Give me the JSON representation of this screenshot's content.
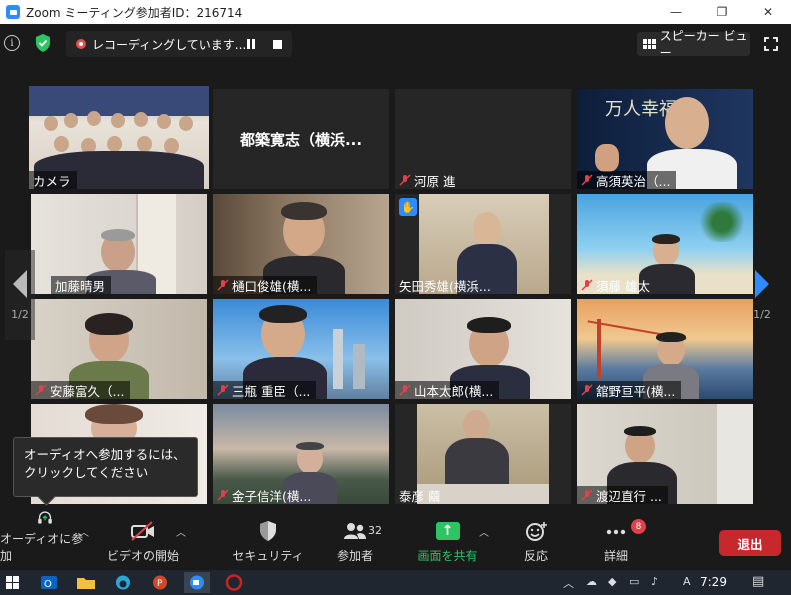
{
  "window": {
    "title": "Zoom ミーティング参加者ID：216714",
    "controls": [
      "—",
      "❐",
      "✕"
    ]
  },
  "topbar": {
    "recording_text": "レコーディングしています...",
    "speaker_view_label": "スピーカー ビュー"
  },
  "participants": [
    {
      "name": "カメラ",
      "muted": false,
      "active": true
    },
    {
      "name": "都築寛志（横浜...",
      "muted": false,
      "video_off": true
    },
    {
      "name": "河原 進",
      "muted": true
    },
    {
      "name": "高須英治（...",
      "muted": true,
      "background_text": "万人幸福栞"
    },
    {
      "name": "加藤晴男",
      "muted": false
    },
    {
      "name": "樋口俊雄(横...",
      "muted": true
    },
    {
      "name": "矢田秀雄(横浜...",
      "muted": false,
      "hand_raised": true
    },
    {
      "name": "須藤 雄太",
      "muted": true
    },
    {
      "name": "安藤富久（...",
      "muted": true
    },
    {
      "name": "三瓶 重臣（...",
      "muted": true
    },
    {
      "name": "山本太郎(横...",
      "muted": true
    },
    {
      "name": "舘野亘平(横...",
      "muted": true
    },
    {
      "name": "",
      "muted": false
    },
    {
      "name": "金子信洋(横...",
      "muted": true
    },
    {
      "name": "泰彦 繭",
      "muted": false
    },
    {
      "name": "渡辺直行 ...",
      "muted": true
    }
  ],
  "pagination": {
    "left": "1/2",
    "right": "1/2"
  },
  "tooltip": {
    "text": "オーディオへ参加するには、クリックしてください"
  },
  "toolbar": {
    "audio_label": "オーディオに参加",
    "video_label": "ビデオの開始",
    "security_label": "セキュリティ",
    "participants_label": "参加者",
    "participants_count": "32",
    "share_label": "画面を共有",
    "reactions_label": "反応",
    "more_label": "詳細",
    "more_badge": "8",
    "leave_label": "退出"
  },
  "taskbar": {
    "time": "7:29",
    "ime": "A"
  },
  "colors": {
    "accent_blue": "#2d8cff",
    "share_green": "#2ec464",
    "leave_red": "#c6282c",
    "active_border": "#e4e75a"
  }
}
